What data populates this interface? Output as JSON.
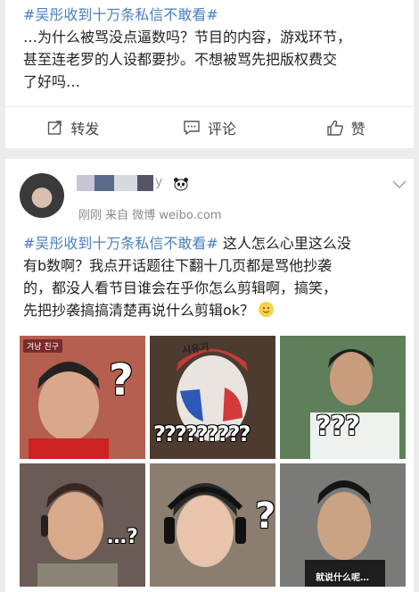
{
  "post1": {
    "topic": "#吴彤收到十万条私信不敢看#",
    "lines": [
      "…为什么被骂没点逼数吗？节目的内容，游戏环节，",
      "甚至连老罗的人设都要抄。不想被骂先把版权费交",
      "了好吗…"
    ],
    "actions": {
      "repost": "转发",
      "comment": "评论",
      "like": "赞"
    }
  },
  "post2": {
    "username_visible": "y",
    "meta": "刚刚  来自 微博 weibo.com",
    "topic": "#吴彤收到十万条私信不敢看#",
    "first_line_rest": " 这人怎么心里这么没",
    "lines": [
      "有b数啊？我点开话题往下翻十几页都是骂他抄袭",
      "的，都没人看节目谁会在乎你怎么剪辑啊，搞笑，",
      "先把抄袭搞搞清楚再说什么剪辑ok？"
    ],
    "images": {
      "t1_tag": "겨냥 친구",
      "t1_mark": "?",
      "t2_tag": "시유기",
      "t2_mark": "?????????",
      "t3_mark": "???",
      "t4_mark": "…?",
      "t5_mark": "?",
      "t6_caption": "就说什么呢…"
    }
  },
  "colors": {
    "topic_blue": "#4a7fc0",
    "text": "#222222",
    "meta_gray": "#8a8a8a",
    "background": "#ececec"
  },
  "icons": [
    "repost-icon",
    "comment-icon",
    "like-icon",
    "panda-icon",
    "chevron-down-icon",
    "smile-emoji-icon"
  ]
}
